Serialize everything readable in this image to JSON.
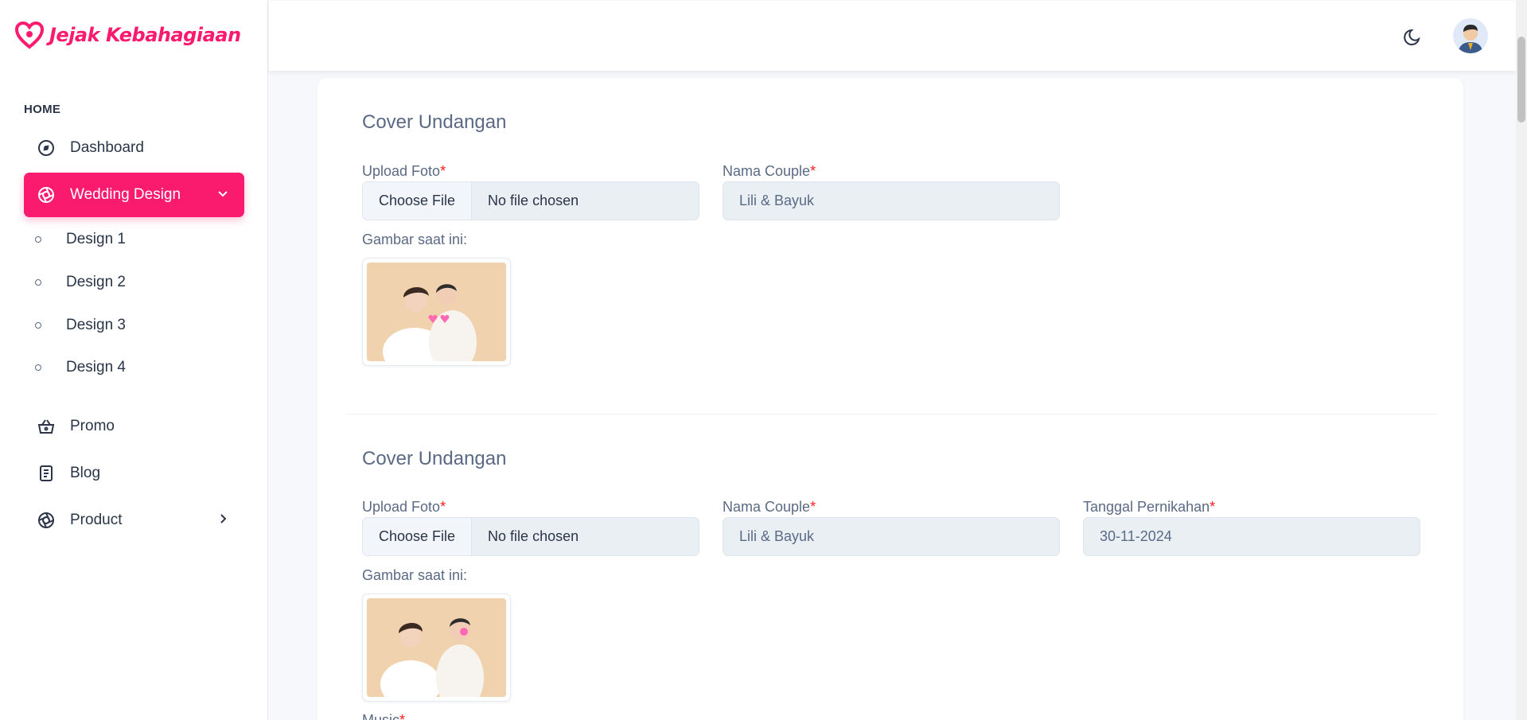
{
  "brand": {
    "name": "Jejak Kebahagiaan",
    "color": "#fa1a6e"
  },
  "sidebar": {
    "caption": "HOME",
    "items": [
      {
        "label": "Dashboard",
        "icon": "dashboard-gauge-icon"
      },
      {
        "label": "Wedding Design",
        "icon": "aperture-icon",
        "active": true,
        "expanded": true
      },
      {
        "label": "Promo",
        "icon": "basket-icon"
      },
      {
        "label": "Blog",
        "icon": "document-icon"
      },
      {
        "label": "Product",
        "icon": "aperture-icon"
      }
    ],
    "sub_items": [
      "Design 1",
      "Design 2",
      "Design 3",
      "Design 4"
    ]
  },
  "topbar": {
    "theme_icon": "moon-icon",
    "avatar": "user-avatar"
  },
  "sections": [
    {
      "title": "Cover Undangan",
      "upload_label": "Upload Foto",
      "file_button": "Choose File",
      "file_status": "No file chosen",
      "couple_label": "Nama Couple",
      "couple_value": "Lili & Bayuk",
      "current_image_label": "Gambar saat ini:"
    },
    {
      "title": "Cover Undangan",
      "upload_label": "Upload Foto",
      "file_button": "Choose File",
      "file_status": "No file chosen",
      "couple_label": "Nama Couple",
      "couple_value": "Lili & Bayuk",
      "date_label": "Tanggal Pernikahan",
      "date_value": "30-11-2024",
      "current_image_label": "Gambar saat ini:",
      "next_label_partial": "Music"
    }
  ],
  "required_marker": "*"
}
